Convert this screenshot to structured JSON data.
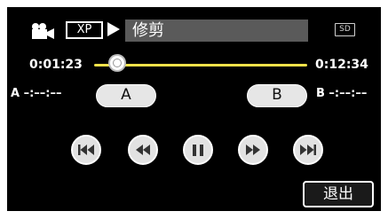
{
  "header": {
    "mode_badge": "XP",
    "title": "修剪",
    "media_badge": "SD"
  },
  "timeline": {
    "current_time": "0:01:23",
    "total_time": "0:12:34",
    "position_fraction": 0.11
  },
  "markers": {
    "a_label": "A –:––:––",
    "b_label": "B –:––:––",
    "a_button": "A",
    "b_button": "B"
  },
  "controls": [
    {
      "icon": "skip-previous-icon"
    },
    {
      "icon": "rewind-icon"
    },
    {
      "icon": "pause-icon"
    },
    {
      "icon": "fast-forward-icon"
    },
    {
      "icon": "skip-next-icon"
    }
  ],
  "footer": {
    "exit_label": "退出"
  },
  "colors": {
    "screen_bg": "#000000",
    "slider": "#f2e24a",
    "button_bg": "#e6e6e6"
  }
}
